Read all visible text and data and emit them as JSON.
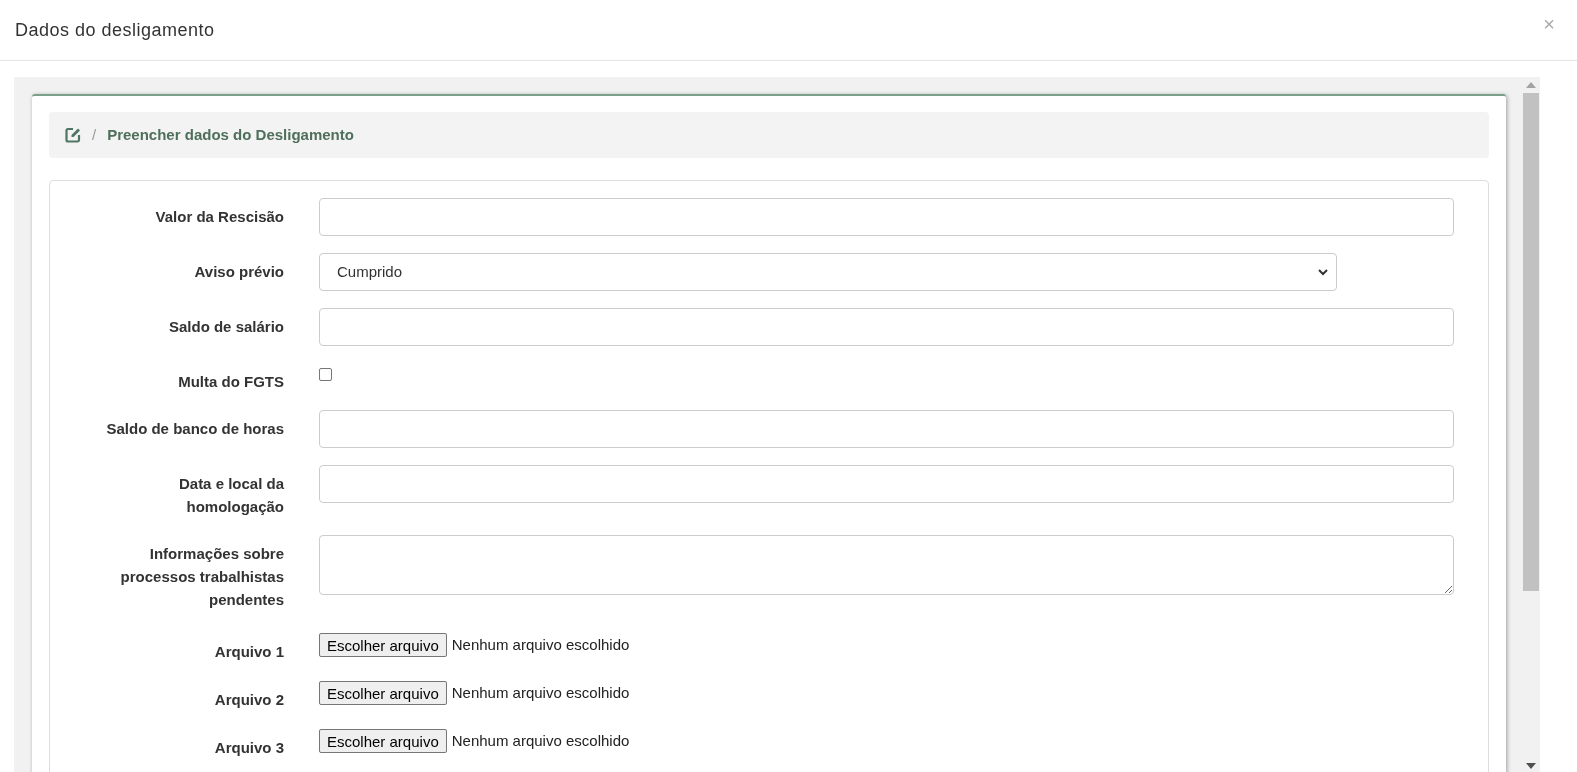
{
  "modal": {
    "title": "Dados do desligamento",
    "close": "×"
  },
  "breadcrumb": {
    "separator": "/",
    "label": "Preencher dados do Desligamento"
  },
  "fields": [
    {
      "kind": "text",
      "label": "Valor da Rescisão"
    },
    {
      "kind": "select",
      "label": "Aviso prévio",
      "value": "Cumprido"
    },
    {
      "kind": "text",
      "label": "Saldo de salário"
    },
    {
      "kind": "checkbox",
      "label": "Multa do FGTS",
      "checked": false
    },
    {
      "kind": "text",
      "label": "Saldo de banco de horas"
    },
    {
      "kind": "text",
      "label": "Data e local da homologação"
    },
    {
      "kind": "textarea",
      "label": "Informações sobre processos trabalhistas pendentes"
    },
    {
      "kind": "file",
      "label": "Arquivo 1",
      "button": "Escolher arquivo",
      "status": "Nenhum arquivo escolhido"
    },
    {
      "kind": "file",
      "label": "Arquivo 2",
      "button": "Escolher arquivo",
      "status": "Nenhum arquivo escolhido"
    },
    {
      "kind": "file",
      "label": "Arquivo 3",
      "button": "Escolher arquivo",
      "status": "Nenhum arquivo escolhido"
    }
  ]
}
